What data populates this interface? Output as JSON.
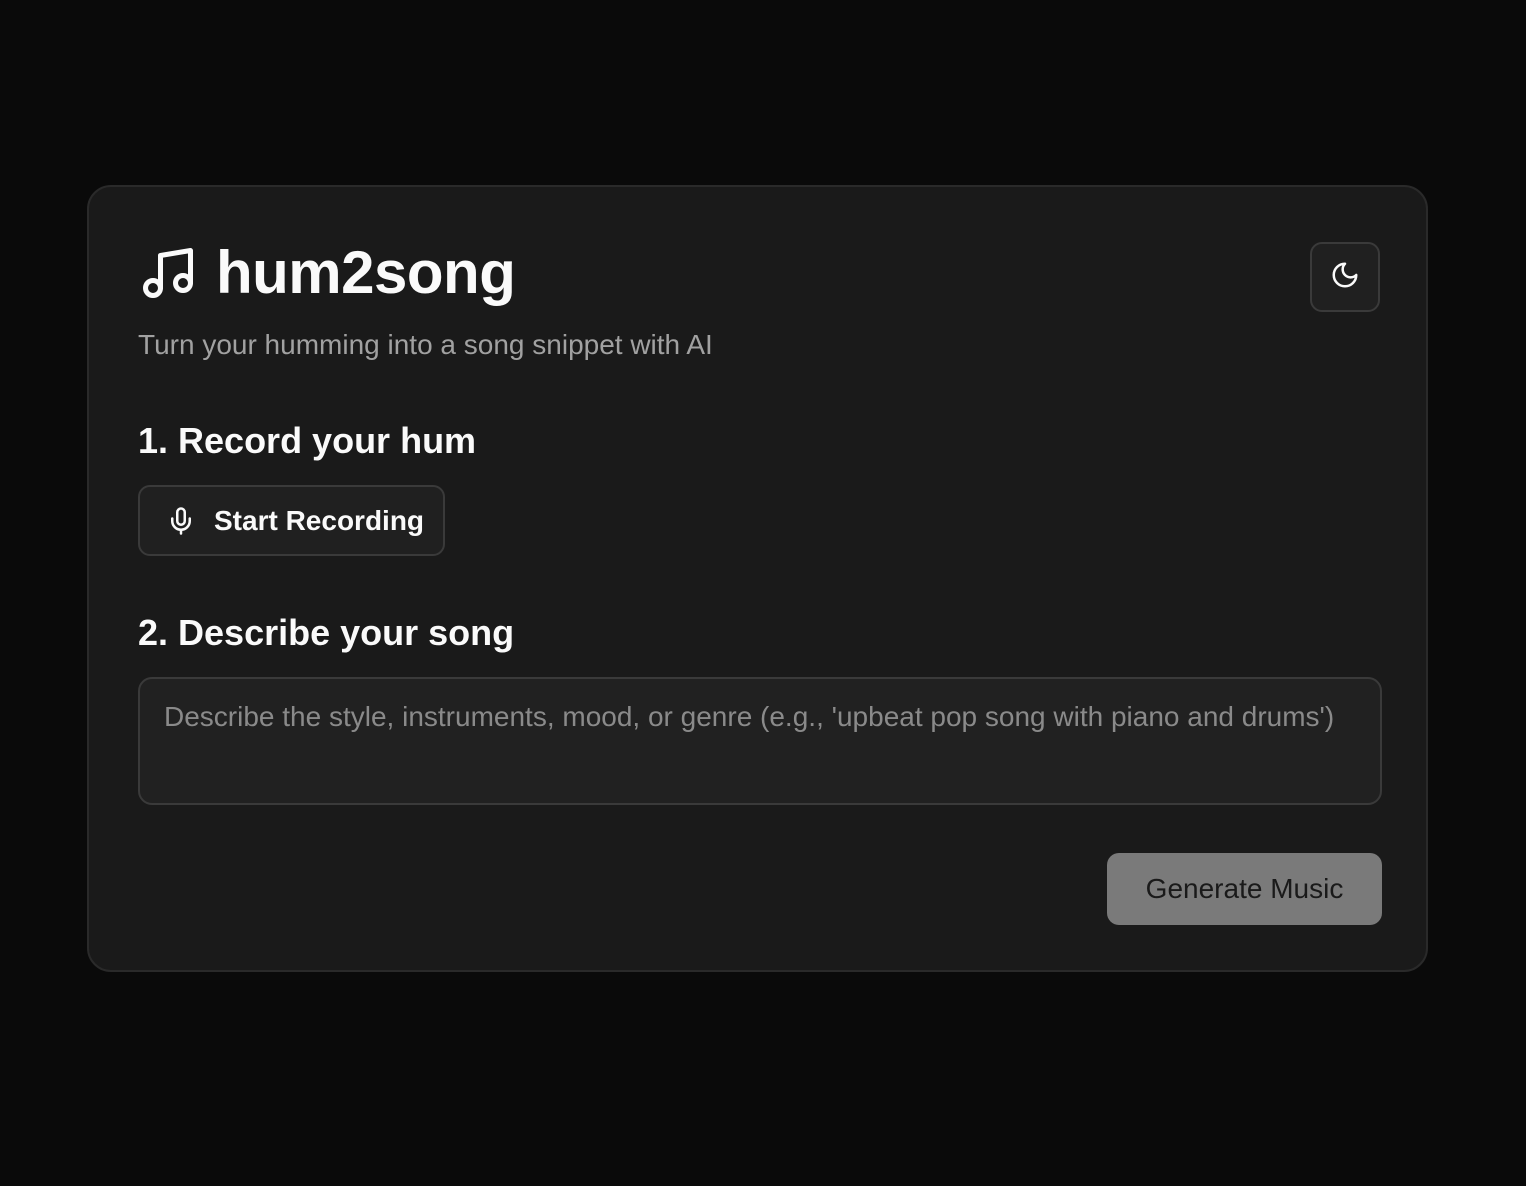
{
  "app": {
    "title": "hum2song",
    "subtitle": "Turn your humming into a song snippet with AI",
    "logo_icon": "music-note-icon"
  },
  "theme_toggle": {
    "icon": "moon-icon",
    "mode": "dark"
  },
  "steps": {
    "record": {
      "heading": "1. Record your hum",
      "button_label": "Start Recording",
      "button_icon": "microphone-icon"
    },
    "describe": {
      "heading": "2. Describe your song",
      "value": "",
      "placeholder": "Describe the style, instruments, mood, or genre (e.g., 'upbeat pop song with piano and drums')"
    }
  },
  "actions": {
    "generate_label": "Generate Music",
    "generate_disabled": true
  },
  "colors": {
    "page_background": "#0a0a0a",
    "card_background": "#1a1a1a",
    "text_primary": "#fafafa",
    "text_muted": "#a1a1a1",
    "disabled_button": "#7a7a7a"
  }
}
